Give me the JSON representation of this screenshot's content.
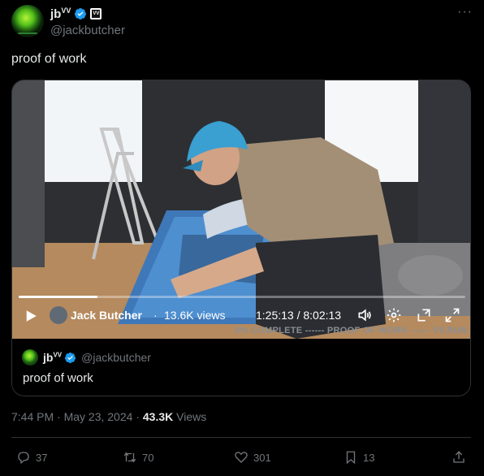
{
  "author": {
    "display_name": "jb",
    "display_name_sup": "VV",
    "handle": "@jackbutcher",
    "verified": true,
    "affiliate_badge_text": "VV"
  },
  "tweet": {
    "text": "proof of work",
    "timestamp": "7:44 PM · May 23, 2024",
    "views_count": "43.3K",
    "views_label": "Views"
  },
  "video": {
    "channel_name": "Jack Butcher",
    "channel_views": "13.6K views",
    "separator": "·",
    "time_display": "1:25:13 / 8:02:13",
    "progress_fraction": 0.177,
    "overlay_text": "0% COMPLETE ------ PROOF OF WORK ------ VV.RUN"
  },
  "quote": {
    "display_name": "jb",
    "display_name_sup": "VV",
    "handle": "@jackbutcher",
    "text": "proof of work"
  },
  "actions": {
    "replies": "37",
    "reposts": "70",
    "likes": "301",
    "bookmarks": "13"
  },
  "colors": {
    "background": "#000000",
    "text_primary": "#e7e9ea",
    "text_secondary": "#71767b",
    "verified_blue": "#1d9bf0",
    "border": "#2f3336"
  }
}
